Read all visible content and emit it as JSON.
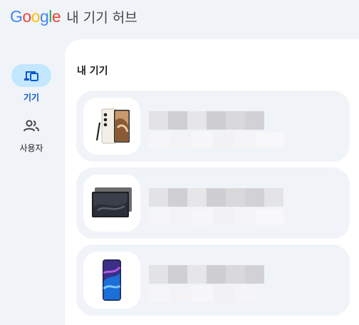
{
  "header": {
    "logo_letters": [
      {
        "ch": "G",
        "color": "#4285F4"
      },
      {
        "ch": "o",
        "color": "#EA4335"
      },
      {
        "ch": "o",
        "color": "#FBBC05"
      },
      {
        "ch": "g",
        "color": "#4285F4"
      },
      {
        "ch": "l",
        "color": "#34A853"
      },
      {
        "ch": "e",
        "color": "#EA4335"
      }
    ],
    "app_title": "내 기기 허브"
  },
  "rail": {
    "items": [
      {
        "label": "기기",
        "icon": "devices-icon",
        "active": true
      },
      {
        "label": "사용자",
        "icon": "people-icon",
        "active": false
      }
    ]
  },
  "main": {
    "section_title": "내 기기",
    "devices": [
      {
        "kind": "phone-with-pen",
        "image": "galaxy-s23-ultra-image"
      },
      {
        "kind": "tablet",
        "image": "galaxy-tab-image"
      },
      {
        "kind": "phone",
        "image": "galaxy-s24-image"
      }
    ]
  },
  "colors": {
    "accent": "#0b57d0",
    "active_pill": "#c2e7ff",
    "background": "#f0f4f9",
    "card": "#f0f4f9",
    "panel": "#ffffff"
  }
}
